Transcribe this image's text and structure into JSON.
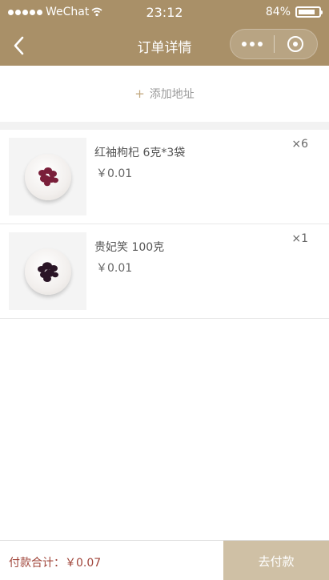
{
  "status_bar": {
    "carrier": "WeChat",
    "time": "23:12",
    "battery": "84%",
    "battery_level": 0.84
  },
  "nav": {
    "title": "订单详情"
  },
  "address": {
    "plus": "+",
    "label": "添加地址"
  },
  "items": [
    {
      "name": "红袖枸杞 6克*3袋",
      "price": "￥0.01",
      "qty": "×6",
      "color": "#7a1f3a"
    },
    {
      "name": "贵妃笑 100克",
      "price": "￥0.01",
      "qty": "×1",
      "color": "#2a1526"
    }
  ],
  "bottom": {
    "total_label": "付款合计：",
    "total_value": "￥0.07",
    "pay_button": "去付款"
  },
  "colors": {
    "nav_bg": "#a99068",
    "accent": "#c1a77e",
    "total_text": "#a0453a",
    "pay_button_bg": "#cfc0a5"
  }
}
